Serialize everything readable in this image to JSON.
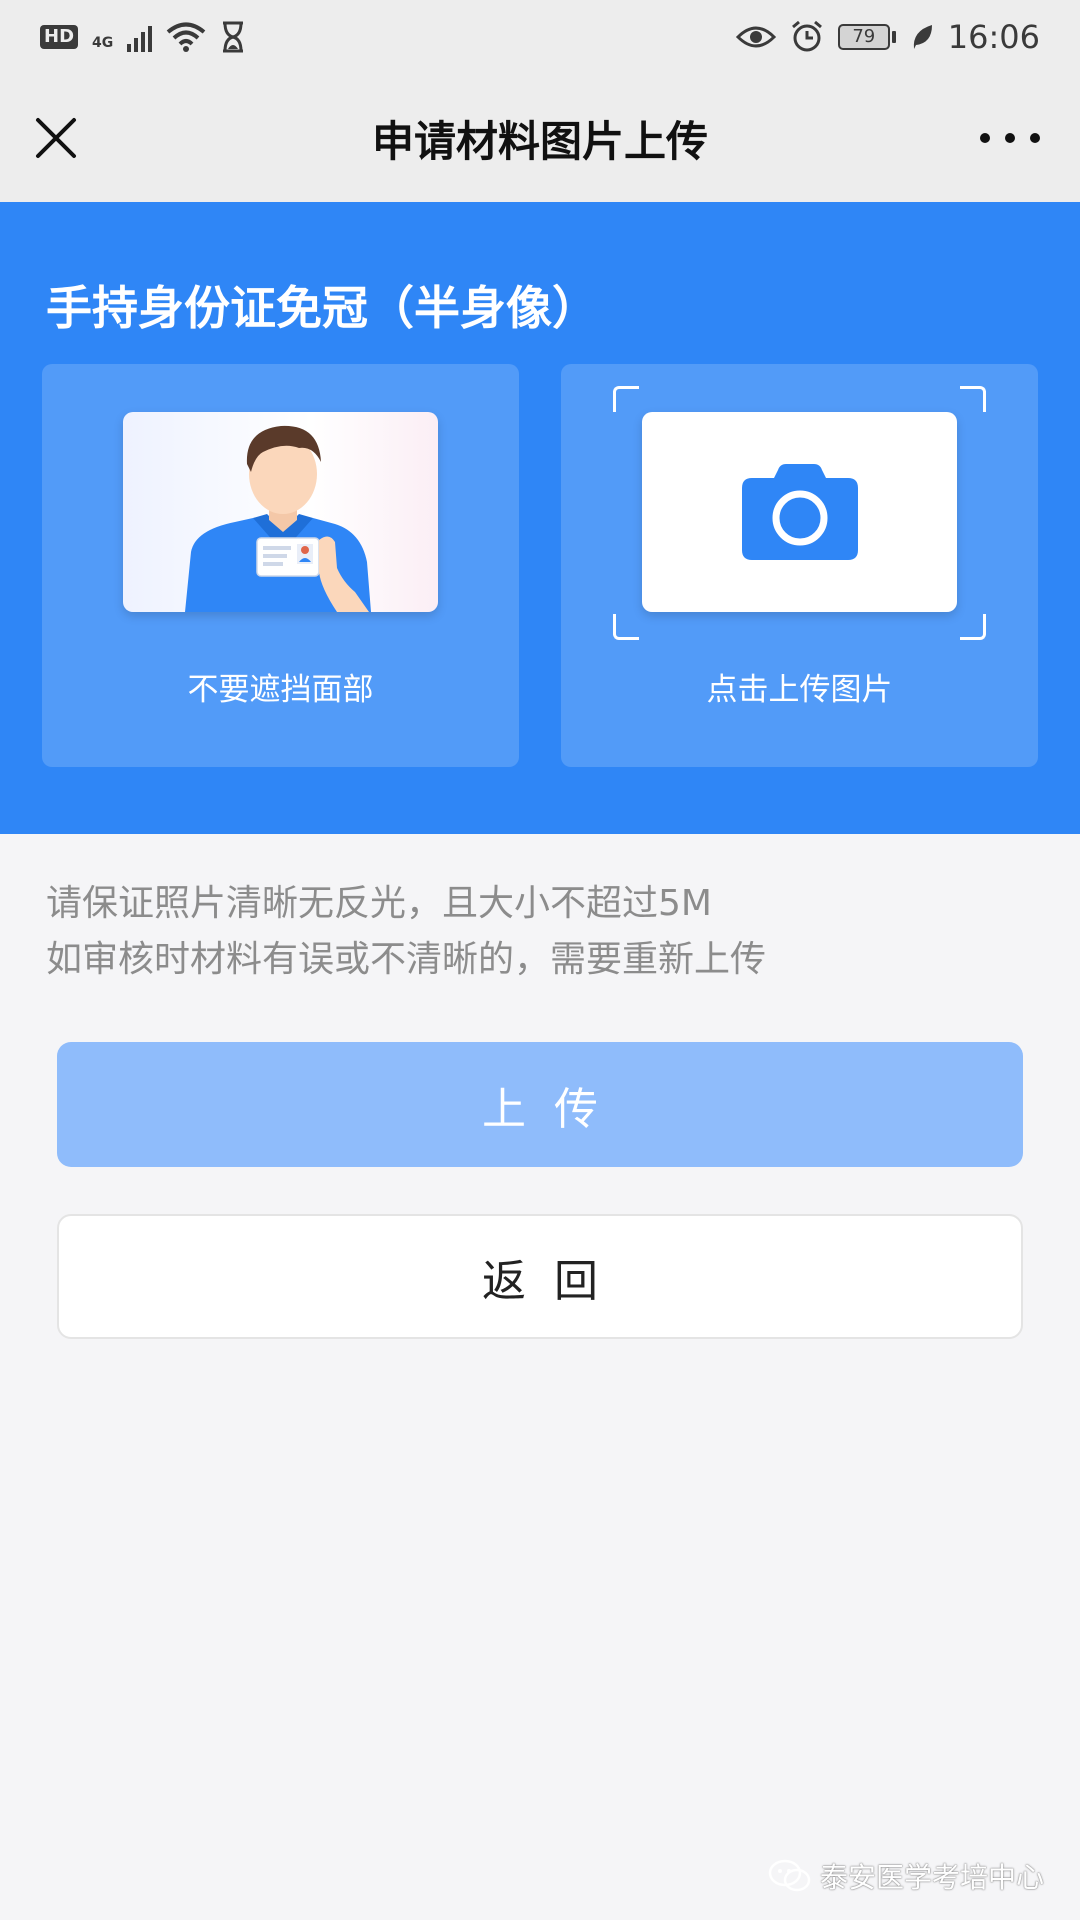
{
  "status_bar": {
    "hd": "HD",
    "network": "4G",
    "battery": "79",
    "time": "16:06",
    "icons": [
      "signal-icon",
      "wifi-icon",
      "hourglass-icon",
      "eye-icon",
      "alarm-icon",
      "battery-icon",
      "leaf-icon"
    ]
  },
  "nav": {
    "title": "申请材料图片上传",
    "close_icon": "close-icon",
    "more_icon": "more-icon"
  },
  "section": {
    "title": "手持身份证免冠（半身像）",
    "sample_label": "不要遮挡面部",
    "upload_label": "点击上传图片",
    "upload_icon": "camera-icon"
  },
  "notes": {
    "line1": "请保证照片清晰无反光，且大小不超过5M",
    "line2": "如审核时材料有误或不清晰的，需要重新上传"
  },
  "buttons": {
    "upload": "上传",
    "back": "返回"
  },
  "watermark": {
    "text": "泰安医学考培中心",
    "icon": "wechat-icon"
  },
  "colors": {
    "primary": "#2f86f6",
    "card": "#529bf8",
    "upload_disabled": "#8fbcfb",
    "background": "#f5f5f7"
  }
}
